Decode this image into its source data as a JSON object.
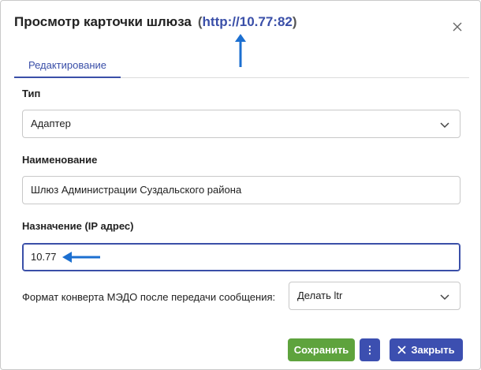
{
  "dialog": {
    "title": "Просмотр карточки шлюза",
    "url_open": "(",
    "url": "http://10.77:82",
    "url_close": ")"
  },
  "tabs": [
    {
      "label": "Редактирование",
      "active": true
    }
  ],
  "form": {
    "type_label": "Тип",
    "type_value": "Адаптер",
    "name_label": "Наименование",
    "name_value": "Шлюз Администрации Суздальского района",
    "ip_label": "Назначение (IP адрес)",
    "ip_value": "10.77",
    "format_label": "Формат конверта МЭДО после передачи сообщения:",
    "format_value": "Делать ltr"
  },
  "buttons": {
    "save": "Сохранить",
    "more": "⋮",
    "close": "Закрыть"
  },
  "colors": {
    "accent": "#3a4fa8",
    "annotation_arrow": "#1c6fd0",
    "save_green": "#5ea33d",
    "button_blue": "#3c4fb0"
  },
  "icons": [
    "close-icon",
    "chevron-down-icon",
    "more-vertical-icon",
    "x-icon",
    "arrow-up-annotation",
    "arrow-left-annotation"
  ]
}
